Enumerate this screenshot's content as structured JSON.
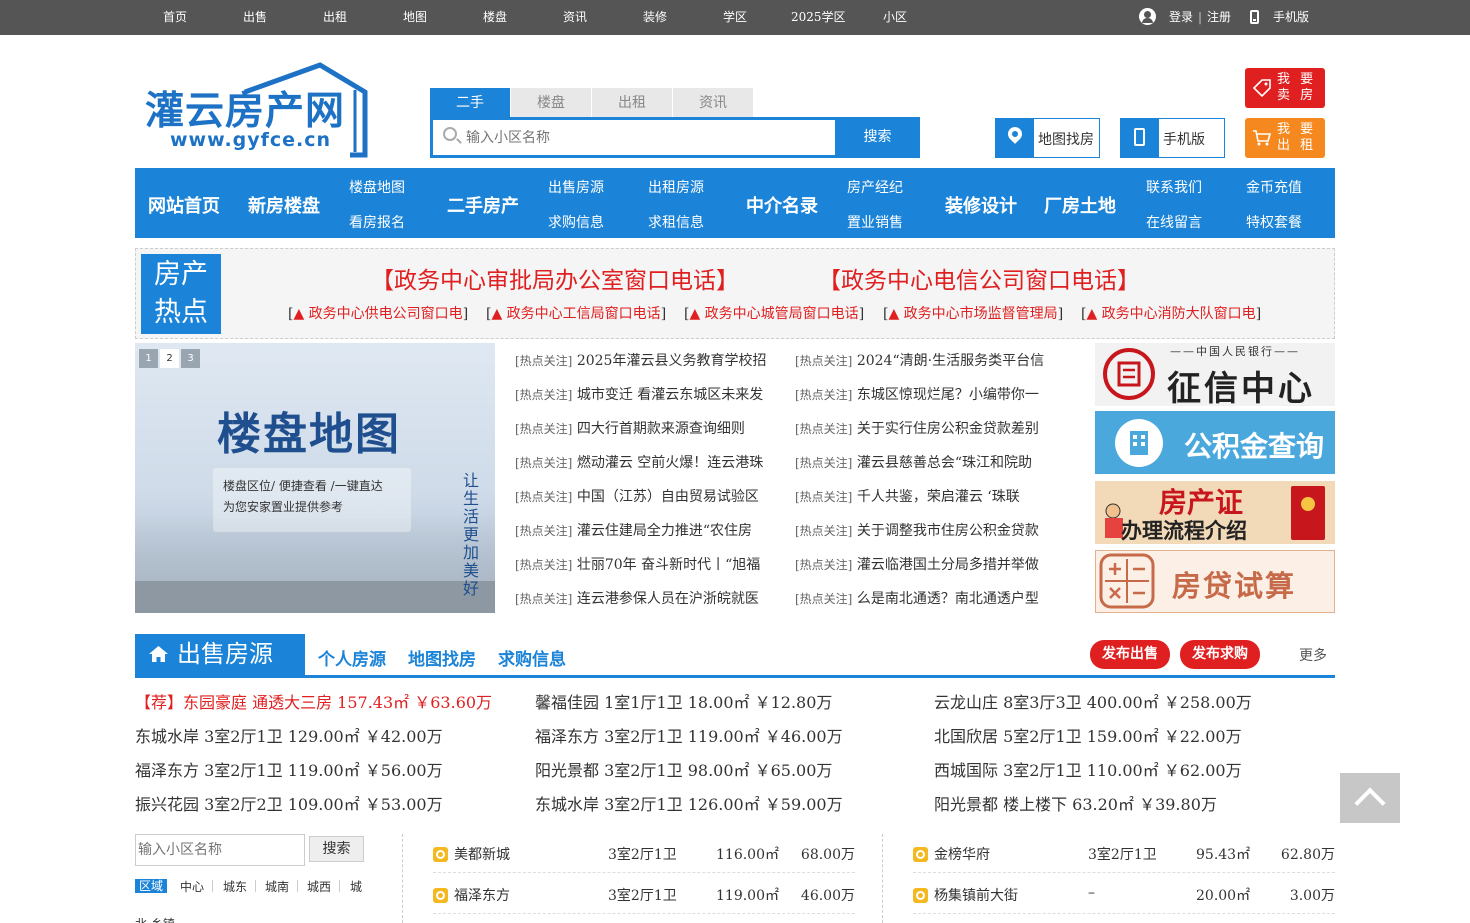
{
  "topbar": {
    "nav": [
      "首页",
      "出售",
      "出租",
      "地图",
      "楼盘",
      "资讯",
      "装修",
      "学区",
      "2025学区",
      "小区"
    ],
    "login": "登录",
    "divider": "|",
    "register": "注册",
    "mobile": "手机版"
  },
  "logo": {
    "name": "灌云房产网",
    "url": "www.gyfce.cn"
  },
  "search": {
    "tabs": [
      "二手",
      "楼盘",
      "出租",
      "资讯"
    ],
    "placeholder": "输入小区名称",
    "button": "搜索",
    "map_search": "地图找房",
    "mobile": "手机版",
    "sell_line1": "我 要",
    "sell_line2": "卖 房",
    "rent_line1": "我 要",
    "rent_line2": "出 租",
    "sell_color": "#e02020",
    "rent_color": "#f5891f"
  },
  "mainnav": {
    "home": "网站首页",
    "newhouse": "新房楼盘",
    "map": "楼盘地图",
    "signup": "看房报名",
    "second": "二手房产",
    "sale": "出售房源",
    "rent": "出租房源",
    "buy": "求购信息",
    "rentwant": "求租信息",
    "agency": "中介名录",
    "broker": "房产经纪",
    "consultant": "置业销售",
    "decor": "装修设计",
    "factory": "厂房土地",
    "contact": "联系我们",
    "coins": "金币充值",
    "message": "在线留言",
    "vip": "特权套餐"
  },
  "hot": {
    "badge1": "房产",
    "badge2": "热点",
    "headline1": "【政务中心审批局办公室窗口电话】",
    "headline2": "【政务中心电信公司窗口电话】",
    "links": [
      "▲ 政务中心供电公司窗口电",
      "▲ 政务中心工信局窗口电话",
      "▲ 政务中心城管局窗口电话",
      "▲ 政务中心市场监督管理局",
      "▲ 政务中心消防大队窗口电"
    ]
  },
  "banner": {
    "pages": [
      "1",
      "2",
      "3"
    ],
    "title": "楼盘地图",
    "sub1": "楼盘区位/ 便捷查看 /一键直达",
    "sub2": "为您安家置业提供参考",
    "vertical": "让生活更加美好"
  },
  "news": {
    "tag": "[热点关注]",
    "left": [
      "2025年灌云县义务教育学校招",
      "城市变迁 看灌云东城区未来发",
      "四大行首期款来源查询细则",
      "燃动灌云 空前火爆！连云港珠",
      "中国（江苏）自由贸易试验区",
      "灌云住建局全力推进“农住房",
      "壮丽70年 奋斗新时代丨“旭福",
      "连云港参保人员在沪浙皖就医"
    ],
    "right": [
      "2024“清朗·生活服务类平台信",
      "东城区惊现烂尾？小编带你一",
      "关于实行住房公积金贷款差别",
      "灌云县慈善总会“珠江和院助",
      "千人共鉴，荣启灌云 ‘珠联",
      "关于调整我市住房公积金贷款",
      "灌云临港国土分局多措并举做",
      "么是南北通透？南北通透户型"
    ]
  },
  "right_images": {
    "credit_small": "——中国人民银行——",
    "credit": "征信中心",
    "fund": "公积金查询",
    "cert1": "房产证",
    "cert2": "办理流程介绍",
    "loan": "房贷试算"
  },
  "sale": {
    "title": "出售房源",
    "links": [
      "个人房源",
      "地图找房",
      "求购信息"
    ],
    "publish_sale": "发布出售",
    "publish_buy": "发布求购",
    "more": "更多",
    "listings": [
      [
        "【荐】东园豪庭 通透大三房 157.43㎡ ￥63.60万",
        "馨福佳园 1室1厅1卫 18.00㎡ ￥12.80万",
        "云龙山庄 8室3厅3卫 400.00㎡ ￥258.00万"
      ],
      [
        "东城水岸 3室2厅1卫 129.00㎡ ￥42.00万",
        "福泽东方 3室2厅1卫 119.00㎡ ￥46.00万",
        "北国欣居 5室2厅1卫 159.00㎡ ￥22.00万"
      ],
      [
        "福泽东方 3室2厅1卫 119.00㎡ ￥56.00万",
        "阳光景都 3室2厅1卫 98.00㎡ ￥65.00万",
        "西城国际 3室2厅1卫 110.00㎡ ￥62.00万"
      ],
      [
        "振兴花园 3室2厅2卫 109.00㎡ ￥53.00万",
        "东城水岸 3室2厅1卫 126.00㎡ ￥59.00万",
        "阳光景都 楼上楼下 63.20㎡ ￥39.80万"
      ]
    ]
  },
  "filter": {
    "placeholder": "输入小区名称",
    "button": "搜索",
    "area_label": "区域",
    "areas": [
      "中心",
      "城东",
      "城南",
      "城西",
      "城"
    ],
    "areas_more": "北   乡镇"
  },
  "table_left": [
    {
      "name": "美都新城",
      "layout": "3室2厅1卫",
      "size": "116.00㎡",
      "price": "68.00万"
    },
    {
      "name": "福泽东方",
      "layout": "3室2厅1卫",
      "size": "119.00㎡",
      "price": "46.00万"
    }
  ],
  "table_right": [
    {
      "name": "金榜华府",
      "layout": "3室2厅1卫",
      "size": "95.43㎡",
      "price": "62.80万"
    },
    {
      "name": "杨集镇前大街",
      "layout": "–",
      "size": "20.00㎡",
      "price": "3.00万"
    }
  ]
}
